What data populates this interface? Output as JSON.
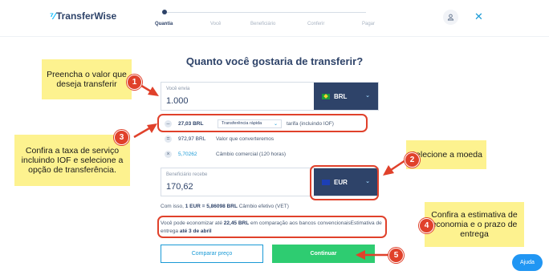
{
  "header": {
    "logo_mark": "⁷⁄",
    "logo_text": "TransferWise",
    "steps": [
      "Quantia",
      "Você",
      "Beneficiário",
      "Conferir",
      "Pagar"
    ]
  },
  "title": "Quanto você gostaria de transferir?",
  "send": {
    "label": "Você envia",
    "value": "1.000",
    "currency": "BRL"
  },
  "fees": {
    "fee_symbol": "–",
    "fee_amount": "27,03 BRL",
    "transfer_option": "Transferência rápida",
    "fee_desc": "tarifa (incluindo IOF)",
    "eq_symbol": "=",
    "converted_amount": "972,97 BRL",
    "converted_desc": "Valor que converteremos",
    "x_symbol": "×",
    "rate_value": "5,70262",
    "rate_desc": "Câmbio comercial (120 horas)"
  },
  "receive": {
    "label": "Beneficiário recebe",
    "value": "170,62",
    "currency": "EUR"
  },
  "effective_rate": {
    "prefix": "Com isso, ",
    "rate": "1 EUR = 5,86098 BRL",
    "suffix": " Câmbio efetivo (VET)"
  },
  "savings": {
    "prefix": "Você pode economizar até ",
    "amount": "22,45 BRL",
    "middle": " em comparação aos bancos convencionaisEstimativa de entrega ",
    "date": "até 3 de abril"
  },
  "buttons": {
    "compare": "Comparar preço",
    "continue": "Continuar",
    "help": "Ajuda"
  },
  "annotations": {
    "note1": "Preencha o valor que deseja transferir",
    "note2": "Selecione a moeda",
    "note3": "Confira a taxa de serviço incluindo IOF e selecione a opção de transferência.",
    "note4": "Confira a estimativa de economia e o prazo de entrega",
    "badge1": "1",
    "badge2": "2",
    "badge3": "3",
    "badge4": "4",
    "badge5": "5"
  },
  "colors": {
    "brand_navy": "#2e4369",
    "accent_blue": "#1a9ad6",
    "continue_green": "#2ecc71",
    "annotation_red": "#e0412b",
    "note_yellow": "#fdf28f"
  }
}
